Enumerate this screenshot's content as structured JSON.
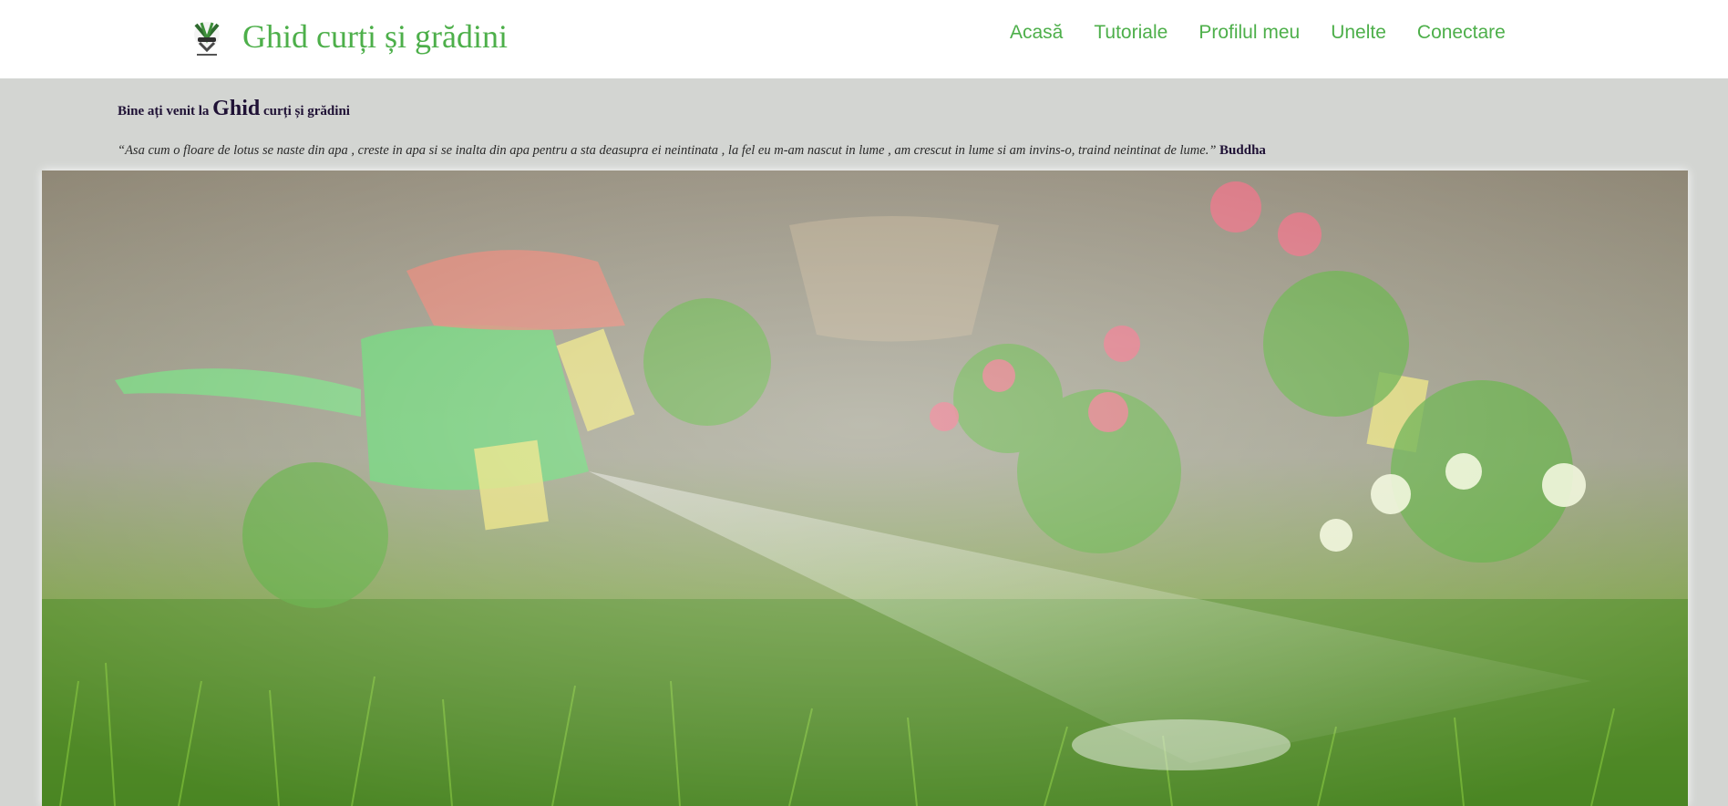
{
  "header": {
    "logo_icon": "garden-tools-logo-icon",
    "title": "Ghid curți și grădini"
  },
  "nav": {
    "items": [
      {
        "label": "Acasă"
      },
      {
        "label": "Tutoriale"
      },
      {
        "label": "Profilul meu"
      },
      {
        "label": "Unelte"
      },
      {
        "label": "Conectare"
      }
    ]
  },
  "welcome": {
    "prefix": "Bine ați venit la",
    "big": "Ghid",
    "suffix": "curți și grădini"
  },
  "quote": {
    "text": "“Asa cum o floare de lotus se naste din apa , creste in apa si se inalta din apa pentru a sta deasupra ei neintinata , la fel eu m-am nascut in lume , am crescut in lume si am invins-o, traind neintinat de lume.”",
    "author": "Buddha"
  },
  "hero": {
    "image_desc": "garden-hero-image"
  },
  "colors": {
    "accent": "#4daf4a",
    "background": "#d3d5d2",
    "text_dark": "#1f1135"
  }
}
